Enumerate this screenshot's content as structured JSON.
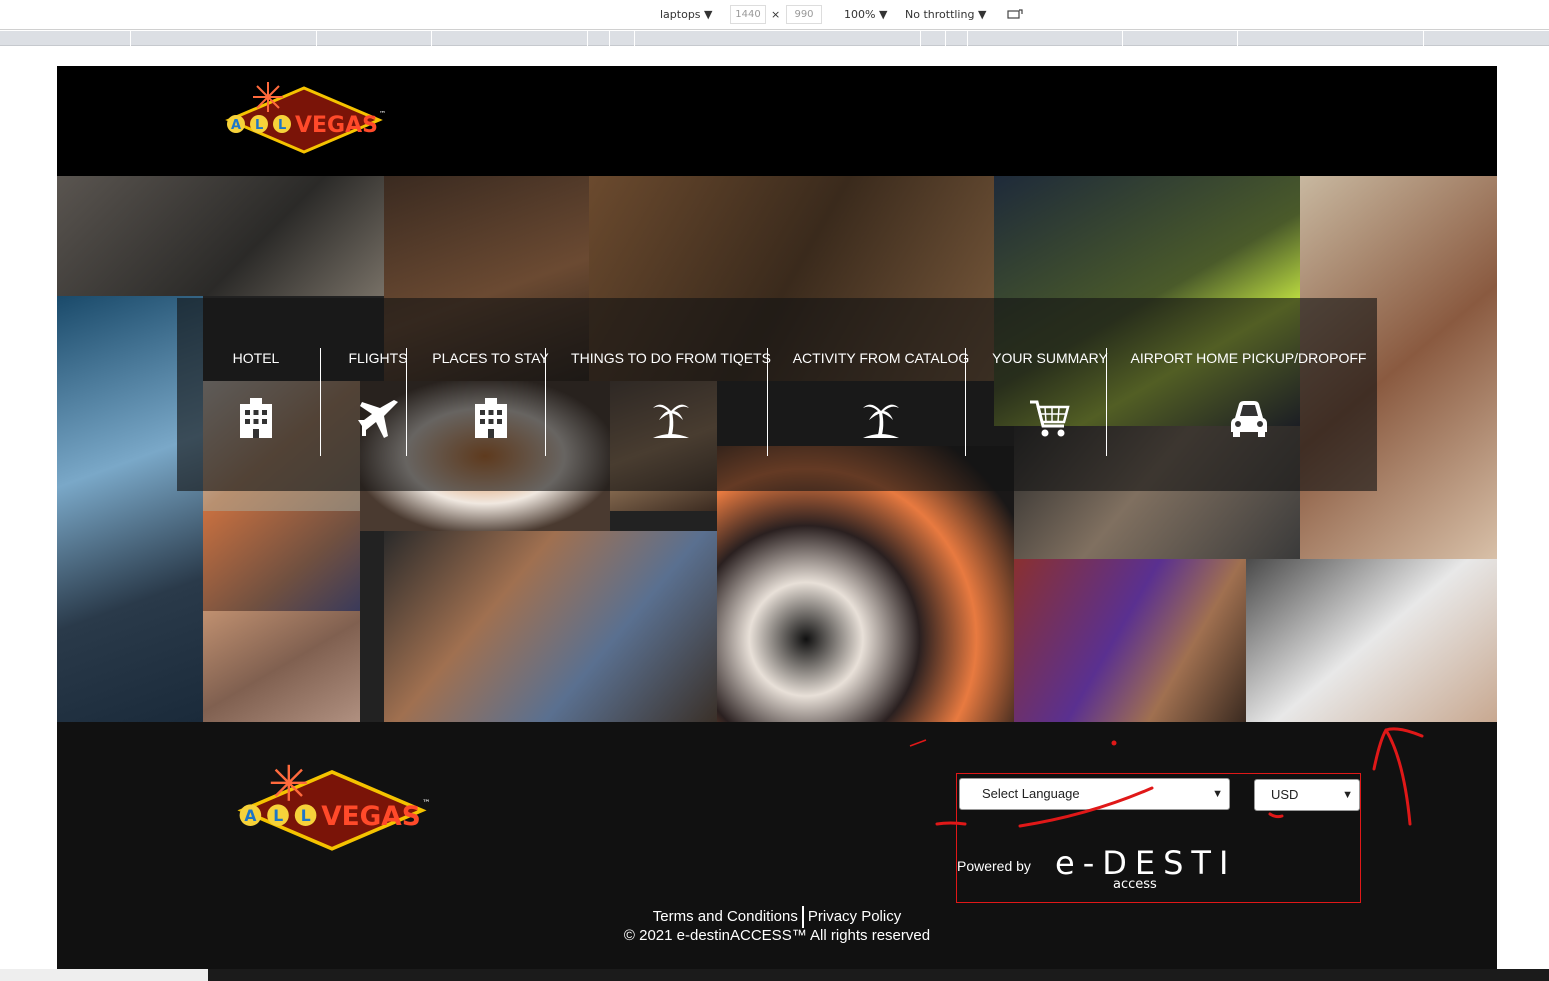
{
  "devtools": {
    "device": "laptops",
    "width": "1440",
    "times": "×",
    "height": "990",
    "zoom": "100%",
    "throttling": "No throttling"
  },
  "header": {
    "logo_text_all": "ALL",
    "logo_text_vegas": "VEGAS",
    "logo_tm": "™"
  },
  "nav": {
    "items": [
      {
        "label": "HOTEL",
        "icon": "hotel-icon"
      },
      {
        "label": "FLIGHTS",
        "icon": "airplane-icon"
      },
      {
        "label": "PLACES TO STAY",
        "icon": "hotel-icon"
      },
      {
        "label": "THINGS TO DO FROM TIQETS",
        "icon": "palm-tree-icon"
      },
      {
        "label": "ACTIVITY FROM CATALOG",
        "icon": "palm-tree-icon"
      },
      {
        "label": "YOUR SUMMARY",
        "icon": "shopping-cart-icon"
      },
      {
        "label": "AIRPORT HOME PICKUP/DROPOFF",
        "icon": "car-icon"
      }
    ]
  },
  "footer": {
    "language_select": "Select Language",
    "currency_select": "USD",
    "powered_by": "Powered by",
    "brand_main": "e-DESTIN",
    "brand_sub": "access",
    "terms": "Terms and Conditions",
    "privacy": "Privacy Policy",
    "copyright": "© 2021 e-destinACCESS™ All rights reserved"
  },
  "colors": {
    "accent_red": "#e01818",
    "page_bg": "#111111",
    "header_bg": "#000000"
  }
}
